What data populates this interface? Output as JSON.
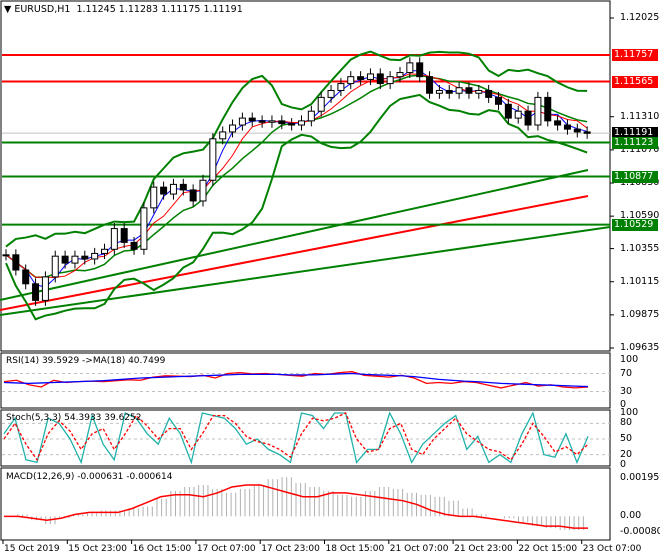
{
  "header": {
    "symbol": "EURUSD,H1",
    "open": "1.11245",
    "high": "1.11283",
    "low": "1.11175",
    "close": "1.11191"
  },
  "price_axis": [
    "1.12025",
    "1.11310",
    "1.11070",
    "1.10830",
    "1.10590",
    "1.10355",
    "1.10115",
    "1.09875",
    "1.09635"
  ],
  "levels": [
    {
      "value": "1.11757",
      "color": "#ff0000"
    },
    {
      "value": "1.11565",
      "color": "#ff0000"
    },
    {
      "value": "1.11191",
      "color": "#000000"
    },
    {
      "value": "1.11123",
      "color": "#008000"
    },
    {
      "value": "1.10877",
      "color": "#008000"
    },
    {
      "value": "1.10529",
      "color": "#008000"
    }
  ],
  "closes": [
    1.1031,
    1.102,
    1.101,
    1.0998,
    1.1015,
    1.103,
    1.1025,
    1.103,
    1.1028,
    1.1032,
    1.1035,
    1.105,
    1.104,
    1.1035,
    1.1065,
    1.108,
    1.1075,
    1.1082,
    1.1078,
    1.107,
    1.1085,
    1.1115,
    1.112,
    1.1125,
    1.113,
    1.1128,
    1.1127,
    1.1128,
    1.1126,
    1.1125,
    1.1128,
    1.1135,
    1.1145,
    1.115,
    1.1155,
    1.116,
    1.1158,
    1.1162,
    1.1155,
    1.116,
    1.1163,
    1.117,
    1.116,
    1.1148,
    1.115,
    1.1148,
    1.1152,
    1.1148,
    1.115,
    1.1145,
    1.114,
    1.113,
    1.1135,
    1.1125,
    1.1145,
    1.1128,
    1.1125,
    1.1122,
    1.112,
    1.1119
  ],
  "rsi": {
    "label": "RSI(14) 39.5929  ->MA(18) 40.7499",
    "levels": [
      "100",
      "70",
      "30",
      "0"
    ],
    "values": [
      52,
      55,
      45,
      40,
      55,
      50,
      52,
      53,
      52,
      54,
      56,
      55,
      62,
      65,
      64,
      63,
      66,
      60,
      70,
      72,
      69,
      70,
      68,
      66,
      64,
      70,
      68,
      72,
      74,
      66,
      64,
      62,
      66,
      60,
      48,
      50,
      48,
      52,
      50,
      44,
      38,
      44,
      50,
      42,
      45,
      40,
      38,
      40
    ],
    "ma": [
      50,
      49,
      48,
      49,
      50,
      51,
      52,
      53,
      54,
      56,
      58,
      60,
      61,
      62,
      63,
      64,
      65,
      66,
      67,
      68,
      68,
      68,
      68,
      67,
      67,
      67,
      68,
      69,
      70,
      68,
      67,
      66,
      65,
      63,
      60,
      57,
      55,
      53,
      52,
      50,
      48,
      47,
      46,
      45,
      44,
      43,
      42,
      41
    ]
  },
  "stoch": {
    "label": "Stoch(5,3,3) 54.3933 39.6252",
    "levels": [
      "100",
      "80",
      "50",
      "20",
      "0"
    ],
    "k": [
      60,
      90,
      10,
      5,
      90,
      80,
      50,
      5,
      95,
      40,
      10,
      100,
      90,
      60,
      40,
      90,
      60,
      5,
      100,
      95,
      90,
      70,
      40,
      50,
      30,
      20,
      5,
      100,
      95,
      70,
      100,
      100,
      5,
      30,
      30,
      100,
      60,
      5,
      40,
      60,
      80,
      95,
      30,
      55,
      5,
      20,
      5,
      60,
      100,
      20,
      15,
      60,
      5,
      55
    ],
    "d": [
      50,
      80,
      40,
      10,
      60,
      85,
      65,
      30,
      60,
      70,
      30,
      60,
      95,
      75,
      50,
      70,
      70,
      30,
      60,
      95,
      95,
      80,
      55,
      45,
      40,
      30,
      15,
      60,
      90,
      85,
      90,
      100,
      50,
      25,
      30,
      70,
      80,
      30,
      20,
      50,
      70,
      90,
      60,
      45,
      30,
      25,
      10,
      40,
      80,
      55,
      25,
      35,
      20,
      40
    ]
  },
  "macd": {
    "label": "MACD(12,26,9) -0.000631 -0.000614",
    "levels": [
      "0.001959",
      "0.00",
      "-0.000801"
    ],
    "hist": [
      0.0,
      0.0001,
      -0.0002,
      -0.0004,
      -0.0001,
      0.0001,
      0.0002,
      0.0003,
      0.0003,
      0.0004,
      0.0005,
      0.0009,
      0.0013,
      0.0015,
      0.0016,
      0.0014,
      0.0012,
      0.0014,
      0.0016,
      0.0019,
      0.002,
      0.0017,
      0.0015,
      0.0013,
      0.0011,
      0.001,
      0.0013,
      0.0015,
      0.0014,
      0.0012,
      0.0011,
      0.001,
      0.0008,
      0.0004,
      0.0001,
      0.0,
      -0.0001,
      -0.0003,
      -0.0005,
      -0.0006,
      -0.0007,
      -0.0007
    ],
    "signal": [
      0.0,
      0.0,
      -0.0001,
      -0.0002,
      -0.0001,
      0.0001,
      0.0002,
      0.0002,
      0.0002,
      0.0004,
      0.0007,
      0.001,
      0.0011,
      0.0011,
      0.001,
      0.0012,
      0.0015,
      0.0016,
      0.0016,
      0.0014,
      0.0012,
      0.001,
      0.001,
      0.0012,
      0.0012,
      0.0011,
      0.001,
      0.0009,
      0.0008,
      0.0006,
      0.0003,
      0.0001,
      0.0,
      0.0,
      -0.0001,
      -0.0002,
      -0.0003,
      -0.0004,
      -0.0005,
      -0.0005,
      -0.0006,
      -0.0006
    ]
  },
  "time_axis": [
    "15 Oct 2019",
    "15 Oct 23:00",
    "16 Oct 15:00",
    "17 Oct 07:00",
    "17 Oct 23:00",
    "18 Oct 15:00",
    "21 Oct 07:00",
    "21 Oct 23:00",
    "22 Oct 15:00",
    "23 Oct 07:00"
  ]
}
